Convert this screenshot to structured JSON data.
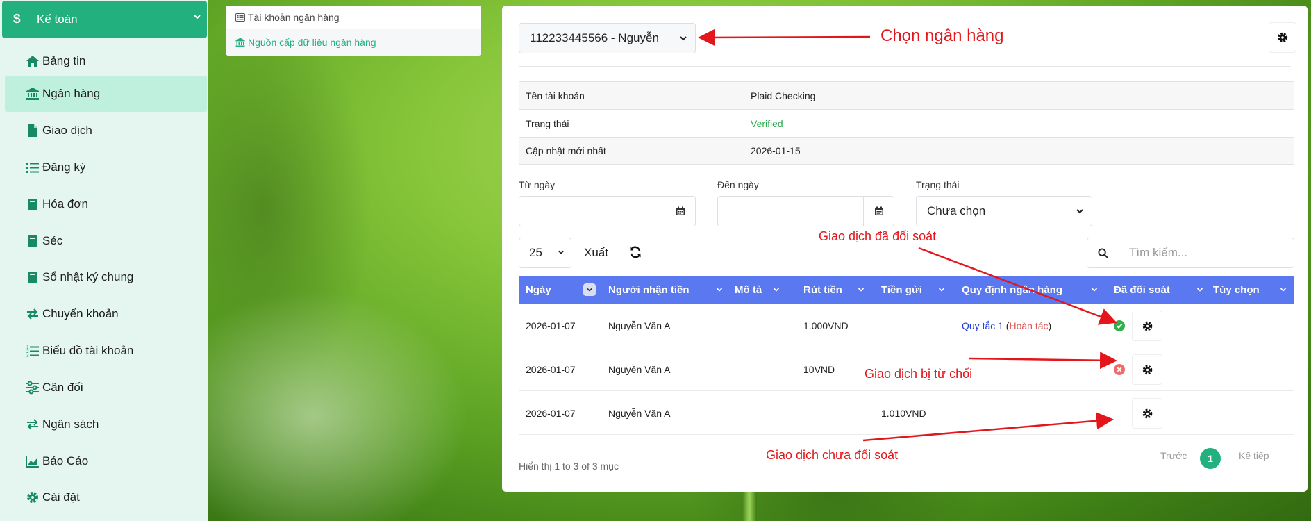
{
  "sidebar": {
    "header": "Kế toán",
    "items": [
      {
        "label": "Bảng tin",
        "icon": "home-icon"
      },
      {
        "label": "Ngân hàng",
        "icon": "bank-icon"
      },
      {
        "label": "Giao dịch",
        "icon": "file-icon"
      },
      {
        "label": "Đăng ký",
        "icon": "list-icon"
      },
      {
        "label": "Hóa đơn",
        "icon": "book-icon"
      },
      {
        "label": "Séc",
        "icon": "book-icon"
      },
      {
        "label": "Sổ nhật ký chung",
        "icon": "book-icon"
      },
      {
        "label": "Chuyển khoản",
        "icon": "exchange-icon"
      },
      {
        "label": "Biểu đồ tài khoản",
        "icon": "list-ol-icon"
      },
      {
        "label": "Cân đối",
        "icon": "sliders-icon"
      },
      {
        "label": "Ngân sách",
        "icon": "exchange-icon"
      },
      {
        "label": "Báo Cáo",
        "icon": "chart-area-icon"
      },
      {
        "label": "Cài đặt",
        "icon": "gear-icon"
      }
    ]
  },
  "submenu": {
    "item1": "Tài khoản ngân hàng",
    "item2": "Nguồn cấp dữ liệu ngân hàng"
  },
  "bank_select": {
    "value": "112233445566 - Nguyễn"
  },
  "account_info": [
    {
      "key": "Tên tài khoản",
      "value": "Plaid Checking"
    },
    {
      "key": "Trạng thái",
      "value": "Verified",
      "color": "#2fa84f"
    },
    {
      "key": "Cập nhật mới nhất",
      "value": "2026-01-15"
    }
  ],
  "filters": {
    "from_label": "Từ ngày",
    "to_label": "Đến ngày",
    "status_label": "Trạng thái",
    "status_value": "Chưa chọn"
  },
  "toolbar": {
    "page_length": "25",
    "export_label": "Xuất",
    "search_placeholder": "Tìm kiếm..."
  },
  "table": {
    "columns": [
      "Ngày",
      "Người nhận tiền",
      "Mô tả",
      "Rút tiền",
      "Tiền gửi",
      "Quy định ngân hàng",
      "Đã đối soát",
      "Tùy chọn"
    ],
    "rows": [
      {
        "date": "2026-01-07",
        "payee": "Nguyễn Văn A",
        "desc": "",
        "withdraw": "1.000VND",
        "deposit": "",
        "rule_name": "Quy tắc 1",
        "rule_action": "Hoàn tác",
        "reconciled": "check"
      },
      {
        "date": "2026-01-07",
        "payee": "Nguyễn Văn A",
        "desc": "",
        "withdraw": "10VND",
        "deposit": "",
        "rule_name": "",
        "rule_action": "",
        "reconciled": "rejected"
      },
      {
        "date": "2026-01-07",
        "payee": "Nguyễn Văn A",
        "desc": "",
        "withdraw": "",
        "deposit": "1.010VND",
        "rule_name": "",
        "rule_action": "",
        "reconciled": "none"
      }
    ]
  },
  "footer": {
    "info": "Hiển thị 1 to 3 of 3 mục",
    "prev": "Trước",
    "page": "1",
    "next": "Kế tiếp"
  },
  "annotations": {
    "choose_bank": "Chọn ngân hàng",
    "reconciled": "Giao dịch đã đối soát",
    "rejected": "Giao dịch bị từ chối",
    "unreconciled": "Giao dịch chưa đối soát"
  },
  "colors": {
    "accent": "#22b07f",
    "table_header": "#5a78f0",
    "annotation": "#e3161b"
  }
}
